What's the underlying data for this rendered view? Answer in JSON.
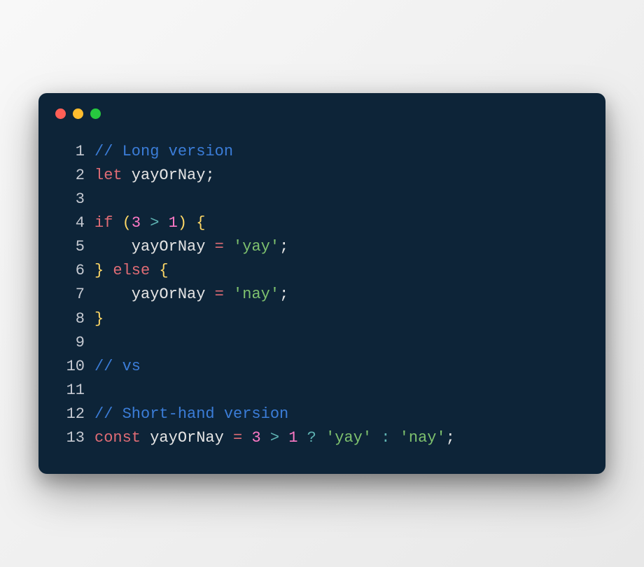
{
  "colors": {
    "background": "#0d2438",
    "red": "#ff5f56",
    "yellow": "#ffbd2e",
    "green": "#27c93f",
    "comment": "#3b7dd8",
    "keyword": "#e06c75",
    "identifier": "#e5e5e5",
    "number": "#ff79c6",
    "operator": "#5fb3b3",
    "string": "#7ec16e",
    "brace": "#ffd866"
  },
  "code": {
    "lines": [
      {
        "num": "1",
        "tokens": [
          {
            "cls": "tok-comment",
            "t": "// Long version"
          }
        ]
      },
      {
        "num": "2",
        "tokens": [
          {
            "cls": "tok-keyword",
            "t": "let"
          },
          {
            "cls": "tok-ident",
            "t": " yayOrNay"
          },
          {
            "cls": "tok-punct",
            "t": ";"
          }
        ]
      },
      {
        "num": "3",
        "tokens": []
      },
      {
        "num": "4",
        "tokens": [
          {
            "cls": "tok-keyword",
            "t": "if"
          },
          {
            "cls": "tok-ident",
            "t": " "
          },
          {
            "cls": "tok-paren",
            "t": "("
          },
          {
            "cls": "tok-num",
            "t": "3"
          },
          {
            "cls": "tok-op",
            "t": " > "
          },
          {
            "cls": "tok-num",
            "t": "1"
          },
          {
            "cls": "tok-paren",
            "t": ")"
          },
          {
            "cls": "tok-ident",
            "t": " "
          },
          {
            "cls": "tok-brace",
            "t": "{"
          }
        ]
      },
      {
        "num": "5",
        "tokens": [
          {
            "cls": "tok-ident",
            "t": "    yayOrNay "
          },
          {
            "cls": "tok-eq",
            "t": "="
          },
          {
            "cls": "tok-ident",
            "t": " "
          },
          {
            "cls": "tok-string",
            "t": "'yay'"
          },
          {
            "cls": "tok-punct",
            "t": ";"
          }
        ]
      },
      {
        "num": "6",
        "tokens": [
          {
            "cls": "tok-brace",
            "t": "}"
          },
          {
            "cls": "tok-ident",
            "t": " "
          },
          {
            "cls": "tok-keyword",
            "t": "else"
          },
          {
            "cls": "tok-ident",
            "t": " "
          },
          {
            "cls": "tok-brace",
            "t": "{"
          }
        ]
      },
      {
        "num": "7",
        "tokens": [
          {
            "cls": "tok-ident",
            "t": "    yayOrNay "
          },
          {
            "cls": "tok-eq",
            "t": "="
          },
          {
            "cls": "tok-ident",
            "t": " "
          },
          {
            "cls": "tok-string",
            "t": "'nay'"
          },
          {
            "cls": "tok-punct",
            "t": ";"
          }
        ]
      },
      {
        "num": "8",
        "tokens": [
          {
            "cls": "tok-brace",
            "t": "}"
          }
        ]
      },
      {
        "num": "9",
        "tokens": []
      },
      {
        "num": "10",
        "tokens": [
          {
            "cls": "tok-comment",
            "t": "// vs"
          }
        ]
      },
      {
        "num": "11",
        "tokens": []
      },
      {
        "num": "12",
        "tokens": [
          {
            "cls": "tok-comment",
            "t": "// Short-hand version"
          }
        ]
      },
      {
        "num": "13",
        "tokens": [
          {
            "cls": "tok-keyword",
            "t": "const"
          },
          {
            "cls": "tok-ident",
            "t": " yayOrNay "
          },
          {
            "cls": "tok-eq",
            "t": "="
          },
          {
            "cls": "tok-ident",
            "t": " "
          },
          {
            "cls": "tok-num",
            "t": "3"
          },
          {
            "cls": "tok-op",
            "t": " > "
          },
          {
            "cls": "tok-num",
            "t": "1"
          },
          {
            "cls": "tok-op",
            "t": " ? "
          },
          {
            "cls": "tok-string",
            "t": "'yay'"
          },
          {
            "cls": "tok-op",
            "t": " : "
          },
          {
            "cls": "tok-string",
            "t": "'nay'"
          },
          {
            "cls": "tok-punct",
            "t": ";"
          }
        ]
      }
    ]
  }
}
